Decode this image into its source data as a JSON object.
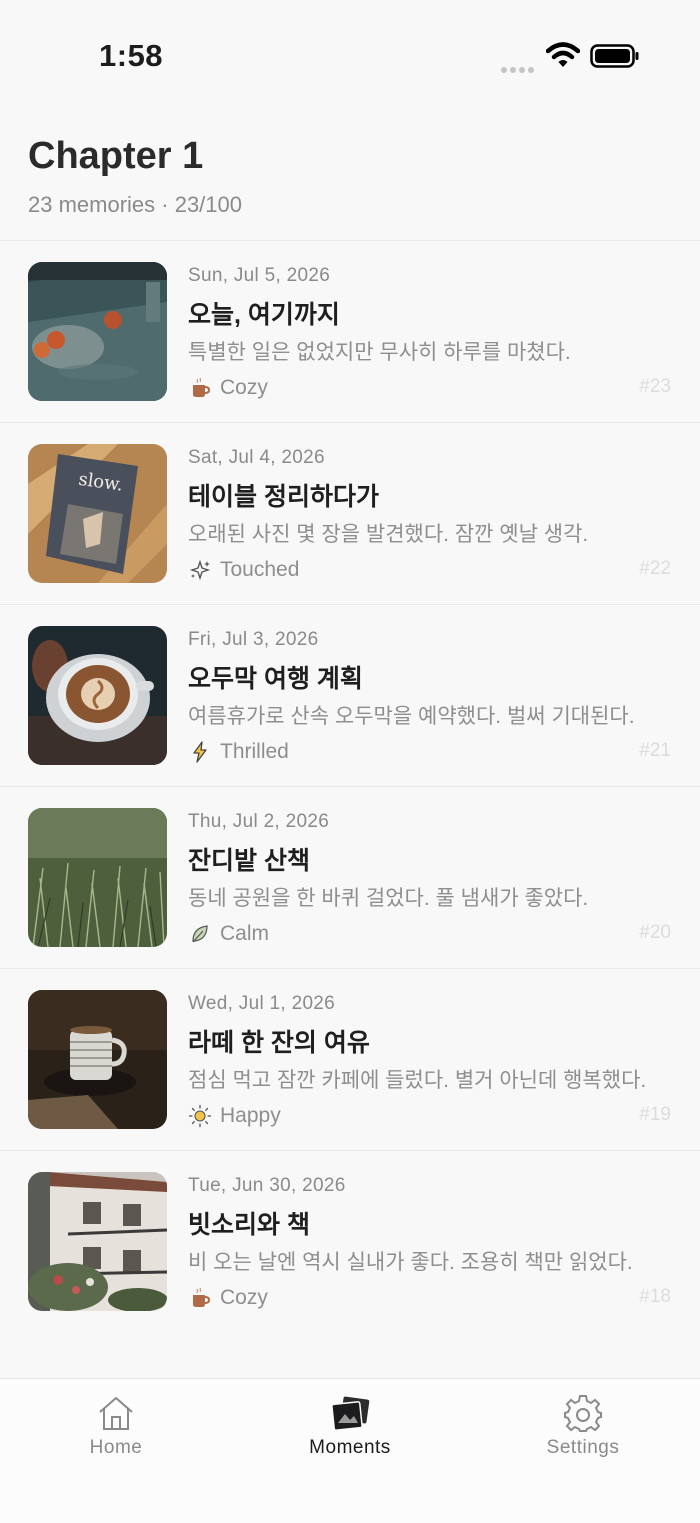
{
  "status": {
    "time": "1:58"
  },
  "header": {
    "title": "Chapter 1",
    "subtitle": "23 memories · 23/100"
  },
  "entries": [
    {
      "date": "Sun, Jul 5, 2026",
      "title": "오늘, 여기까지",
      "body": "특별한 일은 없었지만 무사히 하루를 마쳤다.",
      "mood": "Cozy",
      "mood_icon": "coffee-cup-icon",
      "number": "#23"
    },
    {
      "date": "Sat, Jul 4, 2026",
      "title": "테이블 정리하다가",
      "body": "오래된 사진 몇 장을 발견했다. 잠깐 옛날 생각.",
      "mood": "Touched",
      "mood_icon": "sparkle-icon",
      "number": "#22"
    },
    {
      "date": "Fri, Jul 3, 2026",
      "title": "오두막 여행 계획",
      "body": "여름휴가로 산속 오두막을 예약했다. 벌써 기대된다.",
      "mood": "Thrilled",
      "mood_icon": "lightning-icon",
      "number": "#21"
    },
    {
      "date": "Thu, Jul 2, 2026",
      "title": "잔디밭 산책",
      "body": "동네 공원을 한 바퀴 걸었다. 풀 냄새가 좋았다.",
      "mood": "Calm",
      "mood_icon": "leaf-icon",
      "number": "#20"
    },
    {
      "date": "Wed, Jul 1, 2026",
      "title": "라떼 한 잔의 여유",
      "body": "점심 먹고 잠깐 카페에 들렀다. 별거 아닌데 행복했다.",
      "mood": "Happy",
      "mood_icon": "sun-icon",
      "number": "#19"
    },
    {
      "date": "Tue, Jun 30, 2026",
      "title": "빗소리와 책",
      "body": "비 오는 날엔 역시 실내가 좋다. 조용히 책만 읽었다.",
      "mood": "Cozy",
      "mood_icon": "coffee-cup-icon",
      "number": "#18"
    }
  ],
  "thumb_images": {
    "e0": "photo-fruit-on-table",
    "e1": "photo-slow-magazine",
    "e2": "photo-latte-art",
    "e3": "photo-grass",
    "e4": "photo-coffee-mug",
    "e5": "photo-balcony-building",
    "e1_text": "slow."
  },
  "tabbar": {
    "home": "Home",
    "moments": "Moments",
    "settings": "Settings"
  },
  "colors": {
    "background": "#f8f8f8",
    "active_tab": "#1c1c1e",
    "inactive_tab": "#8a8a8a",
    "secondary_text": "#8e8e8e"
  }
}
